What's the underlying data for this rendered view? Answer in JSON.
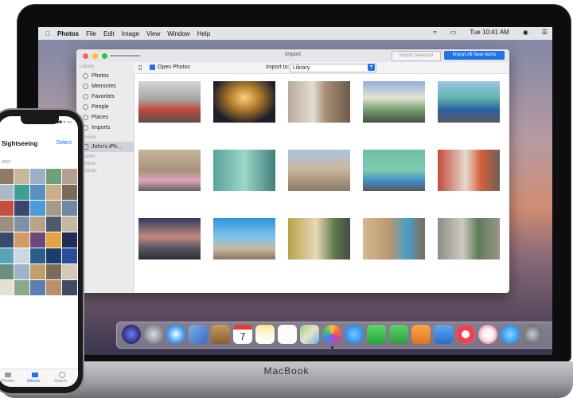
{
  "device": {
    "brand": "MacBook"
  },
  "menubar": {
    "app": "Photos",
    "items": [
      "File",
      "Edit",
      "Image",
      "View",
      "Window",
      "Help"
    ],
    "time": "Tue 10:41 AM"
  },
  "window": {
    "title": "Import",
    "import_selected": "Import Selected",
    "import_all": "Import All New Items",
    "open_photos": "Open Photos",
    "import_to_label": "Import to:",
    "import_to_value": "Library",
    "sidebar": {
      "library_header": "Library",
      "items": [
        "Photos",
        "Memories",
        "Favorites",
        "People",
        "Places",
        "Imports"
      ],
      "devices_header": "Devices",
      "device_item": "John's iPh...",
      "shared_header": "Shared",
      "albums_header": "Albums",
      "projects_header": "Projects"
    }
  },
  "iphone": {
    "time": "9:41",
    "title": "Sightseeing",
    "select": "Select",
    "date": "2016",
    "tabs": [
      "Photos",
      "Albums",
      "Search"
    ]
  }
}
